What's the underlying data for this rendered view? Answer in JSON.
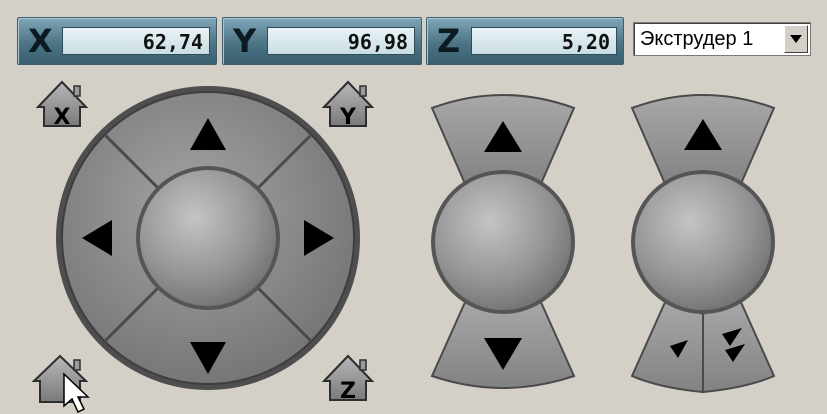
{
  "coords": {
    "x": {
      "axis": "X",
      "value": "62,74"
    },
    "y": {
      "axis": "Y",
      "value": "96,98"
    },
    "z": {
      "axis": "Z",
      "value": "5,20"
    }
  },
  "extruder_select": {
    "value": "Экструдер 1"
  },
  "home_buttons": {
    "x": "X",
    "y": "Y",
    "z": "Z"
  },
  "colors": {
    "panel_bg": "#d4d0c8",
    "coord_bar": "#4c7485",
    "control_gray": "#8e8e8e"
  },
  "icons": {
    "home": "home-icon",
    "up": "arrow-up-icon",
    "down": "arrow-down-icon",
    "left": "arrow-left-icon",
    "right": "arrow-right-icon",
    "small_down": "small-arrow-down-icon",
    "double_down": "double-arrow-down-icon",
    "dropdown": "chevron-down-icon",
    "cursor": "mouse-cursor-icon"
  }
}
